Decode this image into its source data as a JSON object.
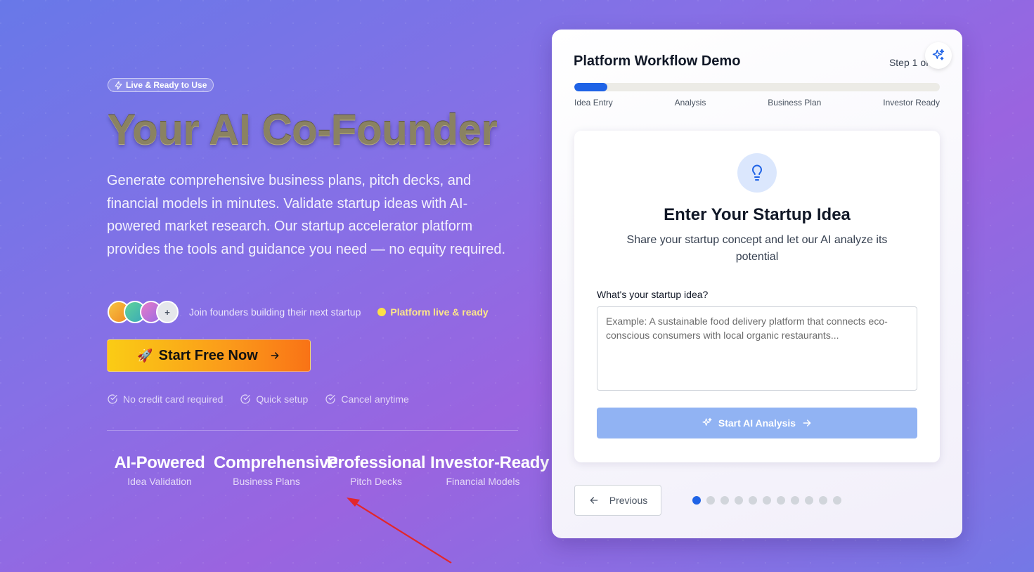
{
  "hero": {
    "badge": "Live & Ready to Use",
    "title": "Your AI Co-Founder",
    "description": "Generate comprehensive business plans, pitch decks, and financial models in minutes. Validate startup ideas with AI-powered market research. Our startup accelerator platform provides the tools and guidance you need — no equity required.",
    "avatar_more": "+",
    "social_text": "Join founders building their next startup",
    "live_status": "Platform live & ready",
    "cta_emoji": "🚀",
    "cta_label": "Start Free Now",
    "checks": [
      "No credit card required",
      "Quick setup",
      "Cancel anytime"
    ],
    "stats": [
      {
        "value": "AI-Powered",
        "label": "Idea Validation"
      },
      {
        "value": "Comprehensive",
        "label": "Business Plans"
      },
      {
        "value": "Professional",
        "label": "Pitch Decks"
      },
      {
        "value": "Investor-Ready",
        "label": "Financial Models"
      }
    ]
  },
  "demo": {
    "title": "Platform Workflow Demo",
    "step_text": "Step 1 of",
    "progress": 0.09,
    "steps": [
      "Idea Entry",
      "Analysis",
      "Business Plan",
      "Investor Ready"
    ],
    "panel": {
      "title": "Enter Your Startup Idea",
      "subtitle": "Share your startup concept and let our AI analyze its potential",
      "field_label": "What's your startup idea?",
      "placeholder": "Example: A sustainable food delivery platform that connects eco-conscious consumers with local organic restaurants...",
      "value": "",
      "button_label": "Start AI Analysis"
    },
    "previous_label": "Previous",
    "dots_total": 11,
    "dots_active": 0
  },
  "colors": {
    "accent": "#1f63e6",
    "cta_start": "#facc15",
    "cta_end": "#f97316",
    "live": "#fde047"
  },
  "icons": {
    "badge": "lightning-icon",
    "cta": "arrow-right-icon",
    "check": "check-circle-icon",
    "sparkle": "sparkles-icon",
    "bulb": "lightbulb-icon",
    "previous": "arrow-left-icon"
  }
}
